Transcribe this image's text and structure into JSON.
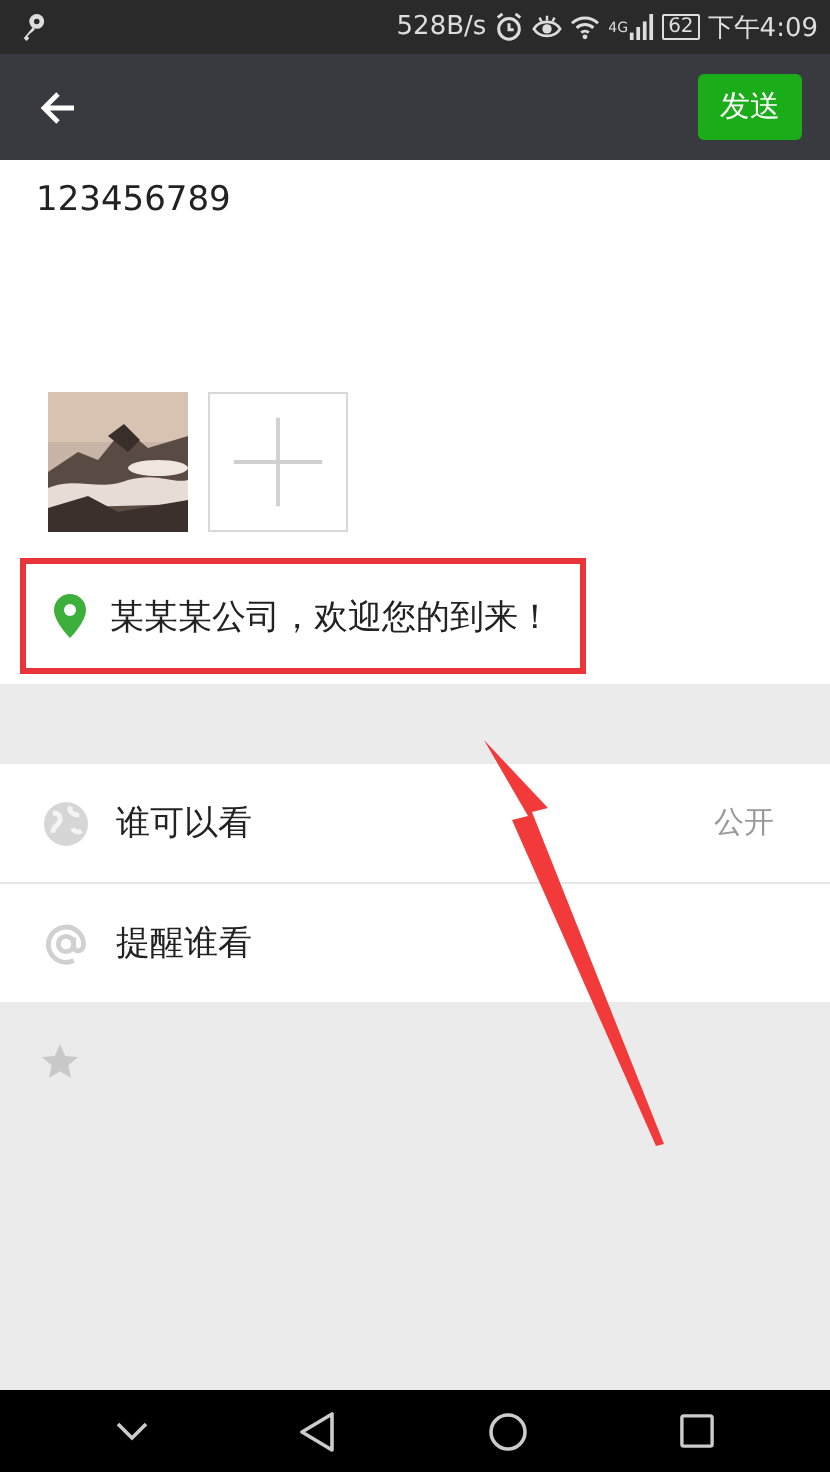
{
  "status_bar": {
    "network_speed": "528B/s",
    "network_type": "4G",
    "battery": "62",
    "time": "下午4:09"
  },
  "toolbar": {
    "send_button": "发送"
  },
  "post": {
    "text": "123456789",
    "photos": [
      {
        "kind": "picture"
      },
      {
        "kind": "add"
      }
    ]
  },
  "location": {
    "label": "某某某公司，欢迎您的到来！",
    "highlighted": true
  },
  "options": [
    {
      "kind": "visibility",
      "label": "谁可以看",
      "value": "公开"
    },
    {
      "kind": "mention",
      "label": "提醒谁看"
    }
  ],
  "annotation": {
    "arrow": true
  }
}
